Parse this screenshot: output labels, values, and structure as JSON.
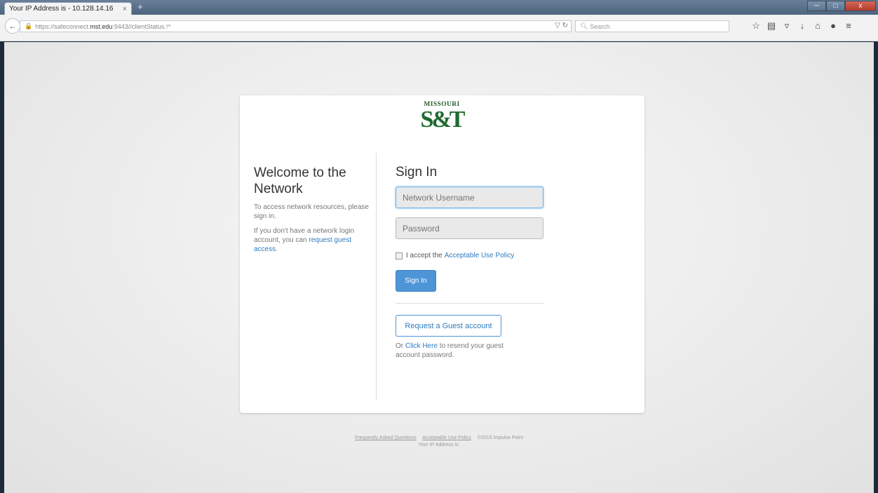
{
  "browser": {
    "tab_title": "Your IP Address is - 10.128.14.16",
    "tab_close": "×",
    "new_tab": "+",
    "url_prefix": "https://safeconnect.",
    "url_domain": "mst.edu",
    "url_suffix": ":9443//clientStatus.!^",
    "search_placeholder": "Search",
    "window_min": "─",
    "window_max": "□",
    "window_close": "x"
  },
  "logo": {
    "top_text": "MISSOURI",
    "main_text": "S&T"
  },
  "welcome": {
    "title": "Welcome to the Network",
    "intro": "To access network resources, please sign in.",
    "guest_prefix": "If you don't have a network login account, you can ",
    "guest_link": "request guest access",
    "guest_suffix": "."
  },
  "signin": {
    "title": "Sign In",
    "username_placeholder": "Network Username",
    "password_placeholder": "Password",
    "accept_prefix": "I accept the",
    "aup_link": "Acceptable Use Policy",
    "signin_button": "Sign In",
    "guest_button": "Request a Guest account",
    "resend_prefix": "Or ",
    "resend_link": "Click Here",
    "resend_suffix": " to resend your guest account password."
  },
  "footer": {
    "faq_link": "Frequently Asked Questions",
    "aup_link": "Acceptable Use Policy",
    "copyright": "©2015 Impulse Point",
    "ip_text": "Your IP Address is:"
  },
  "colors": {
    "accent": "#4e95d8",
    "link": "#2f7bbf",
    "brand_green": "#1f6b2e"
  }
}
